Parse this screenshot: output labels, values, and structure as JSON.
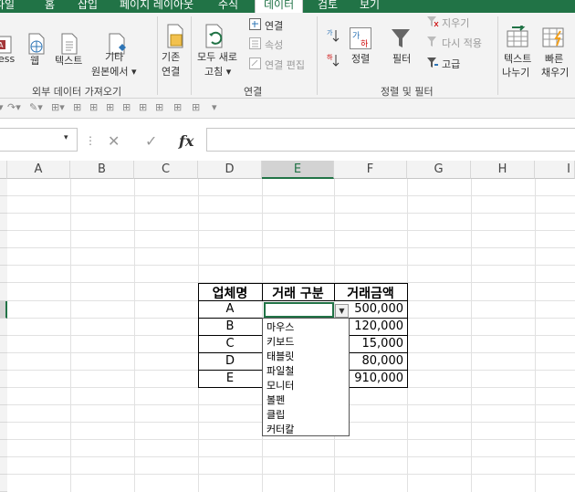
{
  "tabs": [
    {
      "label": "파일",
      "active": false
    },
    {
      "label": "홈",
      "active": false
    },
    {
      "label": "삽입",
      "active": false
    },
    {
      "label": "페이지 레이아웃",
      "active": false
    },
    {
      "label": "수식",
      "active": false
    },
    {
      "label": "데이터",
      "active": true
    },
    {
      "label": "검토",
      "active": false
    },
    {
      "label": "보기",
      "active": false
    }
  ],
  "ribbon": {
    "get_external": {
      "access_label": "ess",
      "web_label": "웹",
      "text_label": "텍스트",
      "other_label1": "기타",
      "other_label2": "원본에서 ▾",
      "group_label": "외부 데이터 가져오기"
    },
    "existing_label1": "기존",
    "existing_label2": "연결",
    "connections": {
      "refresh_label1": "모두 새로",
      "refresh_label2": "고침 ▾",
      "connections_label": "연결",
      "properties_label": "속성",
      "edit_links_label": "연결 편집",
      "group_label": "연결"
    },
    "sort_filter": {
      "sort_label": "정렬",
      "filter_label": "필터",
      "clear_label": "지우기",
      "reapply_label": "다시 적용",
      "advanced_label": "고급",
      "group_label": "정렬 및 필터"
    },
    "data_tools": {
      "text_to_columns1": "텍스트",
      "text_to_columns2": "나누기",
      "flash_fill1": "빠른",
      "flash_fill2": "채우기"
    }
  },
  "formula_bar": {
    "fx": "fx",
    "cancel": "✕",
    "enter": "✓",
    "value": ""
  },
  "columns": [
    "A",
    "B",
    "C",
    "D",
    "E",
    "F",
    "G",
    "H",
    "I"
  ],
  "table": {
    "headers": [
      "업체명",
      "거래 구분",
      "거래금액"
    ],
    "rows": [
      {
        "company": "A",
        "type": "",
        "amount": "500,000"
      },
      {
        "company": "B",
        "type": "",
        "amount": "120,000"
      },
      {
        "company": "C",
        "type": "",
        "amount": "15,000"
      },
      {
        "company": "D",
        "type": "",
        "amount": "80,000"
      },
      {
        "company": "E",
        "type": "",
        "amount": "910,000"
      }
    ]
  },
  "dropdown": {
    "items": [
      "마우스",
      "키보드",
      "태블릿",
      "파일철",
      "모니터",
      "볼펜",
      "클립",
      "커터칼"
    ]
  },
  "colors": {
    "accent": "#217346",
    "header_bg": "#f3f3f3",
    "selected_header": "#d3d3d3"
  }
}
